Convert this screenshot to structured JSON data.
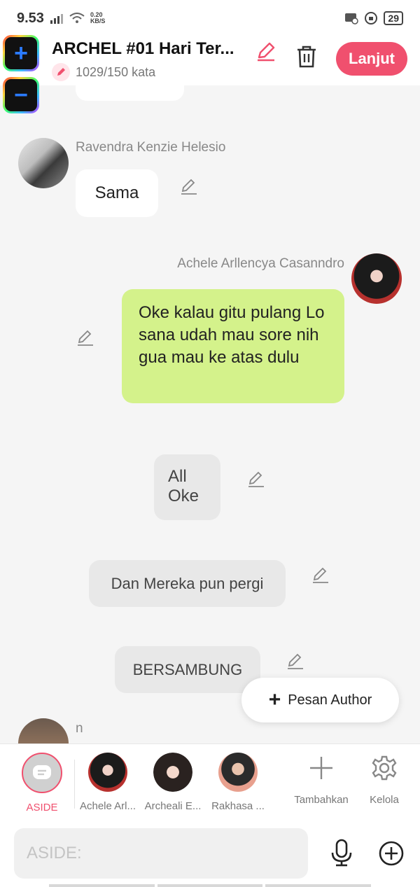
{
  "status": {
    "time": "9.53",
    "net_speed": "0.20",
    "net_unit": "KB/S",
    "battery": "29"
  },
  "header": {
    "title": "ARCHEL #01 Hari Ter...",
    "word_count": "1029/150 kata",
    "continue_label": "Lanjut",
    "zoom_in": "+",
    "zoom_out": "−"
  },
  "chat": {
    "messages": [
      {
        "author": "Ravendra Kenzie Helesio",
        "text": "Sama"
      },
      {
        "author": "Achele Arllencya Casanndro",
        "text": "Oke kalau gitu pulang Lo sana udah mau sore nih gua mau ke atas dulu"
      },
      {
        "author": "",
        "text": "All Oke"
      },
      {
        "author": "",
        "text": "Dan Mereka pun pergi"
      },
      {
        "author": "",
        "text": "BERSAMBUNG"
      },
      {
        "author": "n",
        "text": ""
      }
    ]
  },
  "fab": {
    "label": "Pesan Author"
  },
  "characters": [
    {
      "label": "ASIDE"
    },
    {
      "label": "Achele Arl..."
    },
    {
      "label": "Archeali E..."
    },
    {
      "label": "Rakhasa ..."
    }
  ],
  "tools": {
    "add_label": "Tambahkan",
    "manage_label": "Kelola"
  },
  "input": {
    "placeholder": "ASIDE:"
  },
  "colors": {
    "accent": "#f0506e",
    "green_bubble": "#d4f28b",
    "gray_bubble": "#e8e8e8"
  },
  "icons": [
    "signal-icon",
    "wifi-icon",
    "battery-icon",
    "pencil-icon",
    "trash-icon",
    "plus-icon",
    "gear-icon",
    "microphone-icon",
    "add-circle-icon",
    "message-icon"
  ]
}
